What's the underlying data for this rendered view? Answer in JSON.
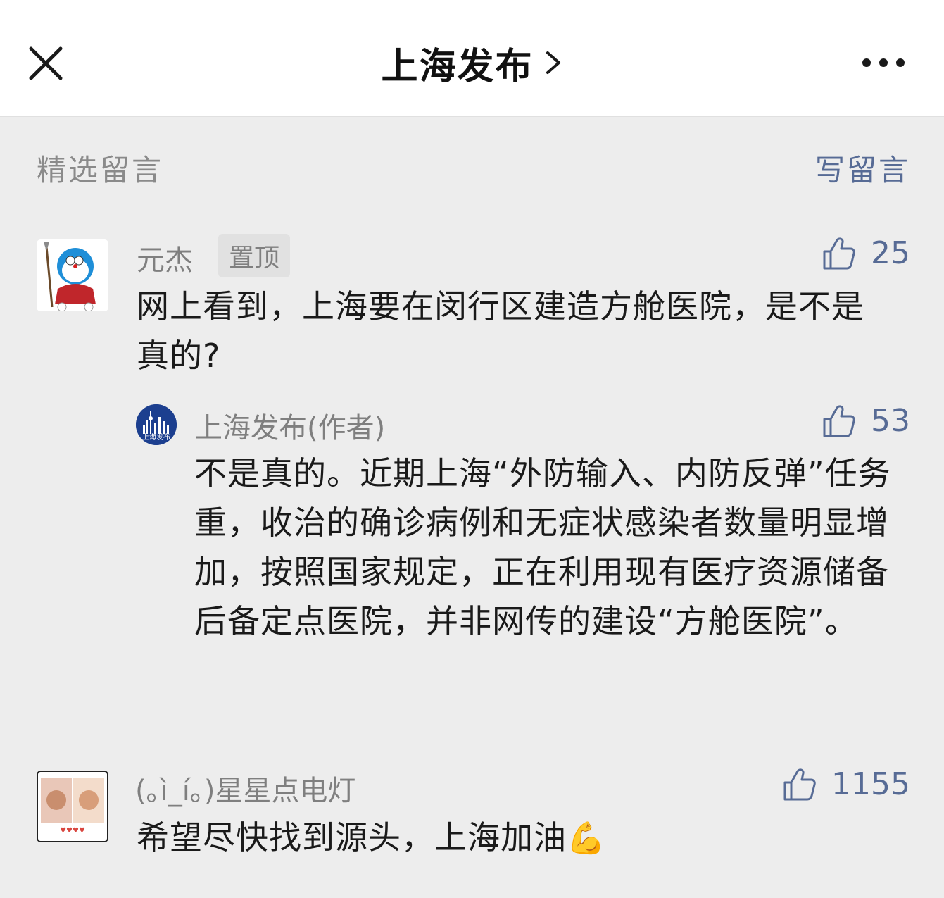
{
  "header": {
    "title": "上海发布",
    "close_icon": "close-icon",
    "chevron_icon": "chevron-right-icon",
    "more_icon": "more-icon"
  },
  "section": {
    "label": "精选留言",
    "write_label": "写留言"
  },
  "comments": [
    {
      "name": "元杰",
      "badge": "置顶",
      "likes": "25",
      "text": "网上看到，上海要在闵行区建造方舱医院，是不是真的?",
      "reply": {
        "name": "上海发布(作者)",
        "avatar_text": "上海发布",
        "likes": "53",
        "text": "不是真的。近期上海“外防输入、内防反弹”任务重，收治的确诊病例和无症状感染者数量明显增加，按照国家规定，正在利用现有医疗资源储备后备定点医院，并非网传的建设“方舱医院”。"
      }
    },
    {
      "name": "(｡ì_í｡)星星点电灯",
      "likes": "1155",
      "text": "希望尽快找到源头，上海加油",
      "emoji": "💪"
    }
  ],
  "colors": {
    "link": "#576b95",
    "background": "#ededed",
    "name_gray": "#7f7f7f"
  }
}
